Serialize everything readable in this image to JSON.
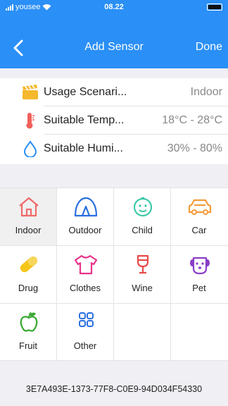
{
  "status_bar": {
    "carrier": "yousee",
    "time": "08.22"
  },
  "nav": {
    "title": "Add Sensor",
    "done_label": "Done"
  },
  "info": [
    {
      "icon": "clapperboard-icon",
      "label": "Usage Scenari...",
      "value": "Indoor"
    },
    {
      "icon": "thermometer-icon",
      "label": "Suitable Temp...",
      "value": "18°C - 28°C"
    },
    {
      "icon": "water-drop-icon",
      "label": "Suitable Humi...",
      "value": "30% - 80%"
    }
  ],
  "scenarios": [
    {
      "label": "Indoor",
      "icon": "house-icon",
      "color": "#f06a6a",
      "selected": true
    },
    {
      "label": "Outdoor",
      "icon": "tent-icon",
      "color": "#2a6fe0"
    },
    {
      "label": "Child",
      "icon": "baby-face-icon",
      "color": "#3cc9a8"
    },
    {
      "label": "Car",
      "icon": "car-icon",
      "color": "#f59a3a"
    },
    {
      "label": "Drug",
      "icon": "pill-icon",
      "color": "#f5c518"
    },
    {
      "label": "Clothes",
      "icon": "shirt-icon",
      "color": "#e8338a"
    },
    {
      "label": "Wine",
      "icon": "wine-glass-icon",
      "color": "#e84a4a"
    },
    {
      "label": "Pet",
      "icon": "dog-icon",
      "color": "#8a3fc8"
    },
    {
      "label": "Fruit",
      "icon": "apple-icon",
      "color": "#3aa832"
    },
    {
      "label": "Other",
      "icon": "grid-icon",
      "color": "#2a6fe0"
    }
  ],
  "device_id": "3E7A493E-1373-77F8-C0E9-94D034F54330"
}
